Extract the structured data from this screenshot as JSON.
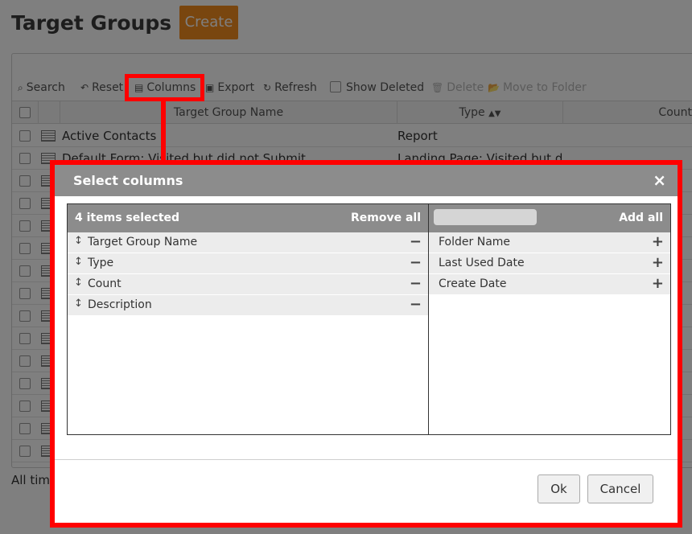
{
  "page": {
    "title": "Target Groups",
    "create_label": "Create"
  },
  "toolbar": {
    "search": "Search",
    "reset": "Reset",
    "columns": "Columns",
    "export": "Export",
    "refresh": "Refresh",
    "show_deleted": "Show Deleted",
    "delete": "Delete",
    "move_to_folder": "Move to Folder"
  },
  "grid": {
    "headers": {
      "name": "Target Group Name",
      "type": "Type",
      "count": "Count"
    },
    "rows": [
      {
        "name": "Active Contacts",
        "type": "Report"
      },
      {
        "name": "Default Form: Visited but did not Submit",
        "type": "Landing Page: Visited but did not Submit"
      }
    ]
  },
  "footer": {
    "text": "All tim"
  },
  "modal": {
    "title": "Select columns",
    "close_glyph": "×",
    "selected_header": "4 items selected",
    "remove_all": "Remove all",
    "add_all": "Add all",
    "search_value": "",
    "selected": [
      "Target Group Name",
      "Type",
      "Count",
      "Description"
    ],
    "available": [
      "Folder Name",
      "Last Used Date",
      "Create Date"
    ],
    "ok": "Ok",
    "cancel": "Cancel"
  },
  "colors": {
    "accent": "#f28c1e",
    "highlight": "#ff0000",
    "modal_header": "#8c8c8c"
  },
  "icons": [
    "search-icon",
    "reset-icon",
    "columns-icon",
    "export-icon",
    "refresh-icon",
    "trash-icon",
    "folder-icon",
    "drag-icon",
    "minus-icon",
    "plus-icon",
    "close-icon",
    "sort-icon",
    "row-report-icon"
  ]
}
